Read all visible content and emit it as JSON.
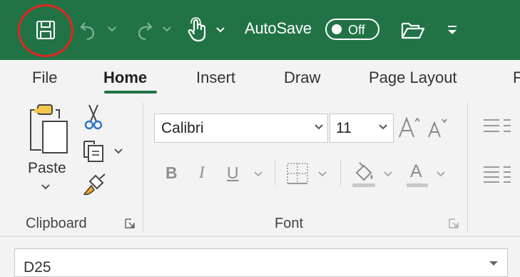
{
  "title_bar": {
    "autosave_label": "AutoSave",
    "autosave_state": "Off",
    "icons": [
      "save-icon",
      "undo-icon",
      "redo-icon",
      "touch-mode-icon",
      "open-folder-icon",
      "customize-qat-icon"
    ]
  },
  "tabs": [
    {
      "label": "File",
      "active": false
    },
    {
      "label": "Home",
      "active": true
    },
    {
      "label": "Insert",
      "active": false
    },
    {
      "label": "Draw",
      "active": false
    },
    {
      "label": "Page Layout",
      "active": false
    },
    {
      "label": "F",
      "active": false
    }
  ],
  "ribbon": {
    "clipboard": {
      "paste_label": "Paste",
      "group_label": "Clipboard"
    },
    "font": {
      "font_name": "Calibri",
      "font_size": "11",
      "bold": "B",
      "italic": "I",
      "underline": "U",
      "font_color": "A",
      "group_label": "Font"
    }
  },
  "name_box": {
    "value": "D25"
  },
  "colors": {
    "title_bar": "#217346",
    "accent": "#217346",
    "highlight_ring": "#e8231f",
    "font_color_swatch": "#c00000",
    "fill_swatch": "#ffff00"
  }
}
